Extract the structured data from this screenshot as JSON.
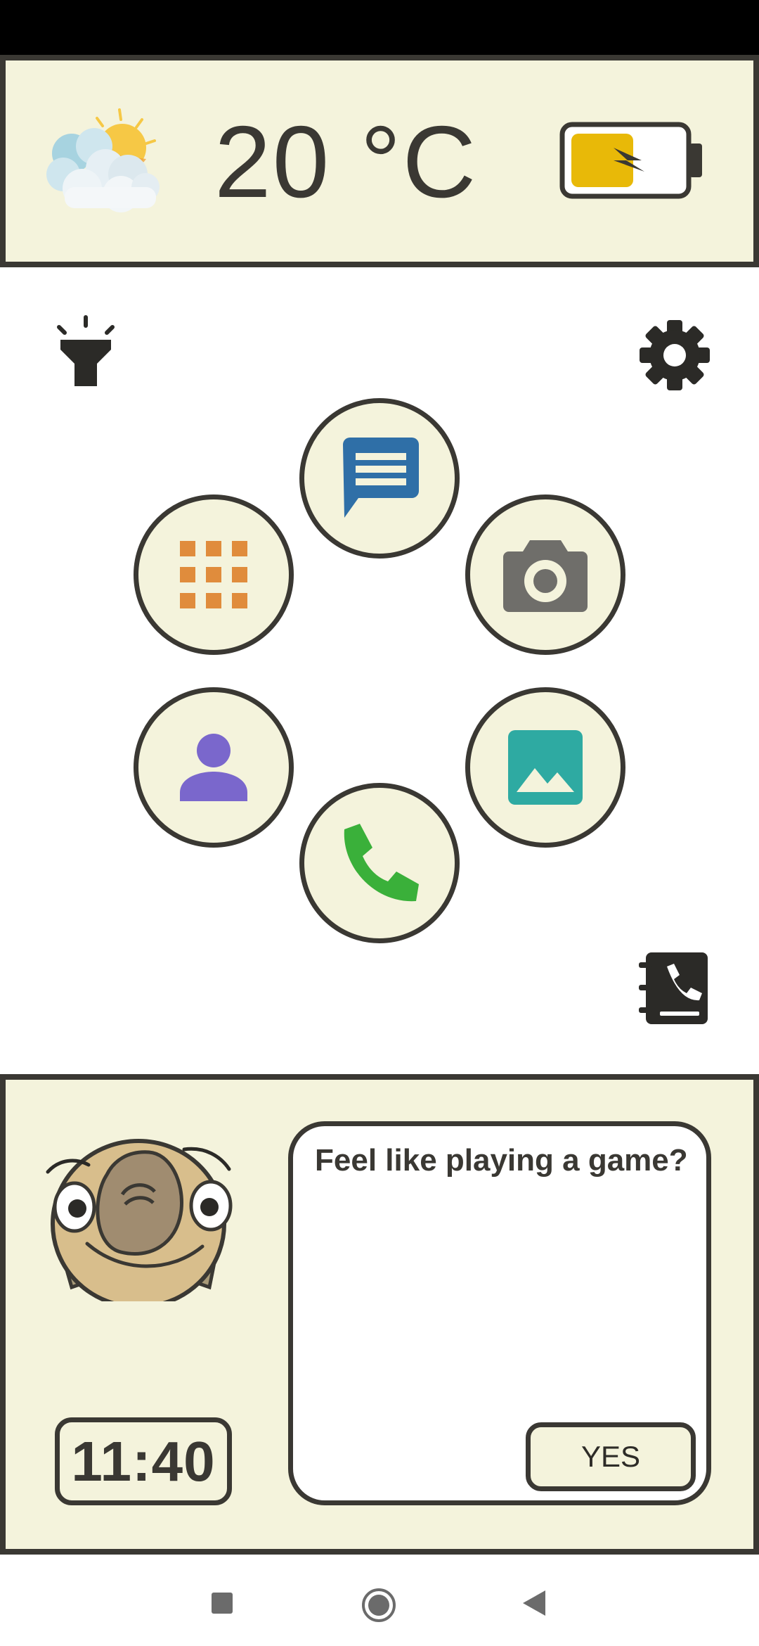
{
  "weather": {
    "temperature": "20 °C",
    "icon": "partly-cloudy-icon"
  },
  "battery": {
    "icon": "battery-charging-icon",
    "fill_color": "#e8b908"
  },
  "corner_icons": {
    "flashlight": "flashlight-icon",
    "settings": "gear-icon",
    "contacts_book": "contacts-book-icon"
  },
  "apps": [
    {
      "name": "messages",
      "icon": "message-icon",
      "color": "#2f6fa7"
    },
    {
      "name": "app-drawer",
      "icon": "grid-icon",
      "color": "#e08c3c"
    },
    {
      "name": "camera",
      "icon": "camera-icon",
      "color": "#6f6e6a"
    },
    {
      "name": "contacts",
      "icon": "person-icon",
      "color": "#7a67cc"
    },
    {
      "name": "gallery",
      "icon": "image-icon",
      "color": "#2eaaa2"
    },
    {
      "name": "phone",
      "icon": "phone-icon",
      "color": "#3ab03a"
    }
  ],
  "assistant": {
    "message": "Feel like playing a game?",
    "yes_label": "YES"
  },
  "clock": {
    "time": "11:40"
  },
  "nav": {
    "recents": "square-icon",
    "home": "circle-icon",
    "back": "triangle-icon"
  },
  "colors": {
    "panel_bg": "#f4f3dc",
    "outline": "#3a3833"
  }
}
